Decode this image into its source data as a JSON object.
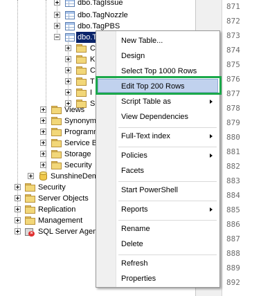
{
  "tree": {
    "items": [
      {
        "label": "dbo.TagIssue",
        "top": 0
      },
      {
        "label": "dbo.TagNozzle"
      },
      {
        "label": "dbo.TagPBS"
      },
      {
        "label": "dbo.T..."
      },
      {
        "label": "C"
      },
      {
        "label": "K"
      },
      {
        "label": "C"
      },
      {
        "label": "T"
      },
      {
        "label": "I"
      },
      {
        "label": "S"
      },
      {
        "label": "Views"
      },
      {
        "label": "Synonyms"
      },
      {
        "label": "Programm"
      },
      {
        "label": "Service Br"
      },
      {
        "label": "Storage"
      },
      {
        "label": "Security"
      },
      {
        "label": "SunshineDem"
      },
      {
        "label": "Security"
      },
      {
        "label": "Server Objects"
      },
      {
        "label": "Replication"
      },
      {
        "label": "Management"
      },
      {
        "label": "SQL Server Agent"
      }
    ]
  },
  "line_numbers": [
    "871",
    "872",
    "873",
    "874",
    "875",
    "876",
    "877",
    "878",
    "879",
    "880",
    "881",
    "882",
    "883",
    "884",
    "885",
    "886",
    "887",
    "888",
    "889",
    "892"
  ],
  "context_menu": {
    "items": [
      {
        "label": "New Table..."
      },
      {
        "label": "Design"
      },
      {
        "label": "Select Top 1000 Rows"
      },
      {
        "label": "Edit Top 200 Rows"
      },
      {
        "label": "Script Table as"
      },
      {
        "label": "View Dependencies"
      },
      {
        "label": "Full-Text index"
      },
      {
        "label": "Policies"
      },
      {
        "label": "Facets"
      },
      {
        "label": "Start PowerShell"
      },
      {
        "label": "Reports"
      },
      {
        "label": "Rename"
      },
      {
        "label": "Delete"
      },
      {
        "label": "Refresh"
      },
      {
        "label": "Properties"
      }
    ],
    "highlighted": "Edit Top 200 Rows"
  },
  "colors": {
    "highlight_border": "#1aa84a",
    "selection": "#0a246a"
  }
}
